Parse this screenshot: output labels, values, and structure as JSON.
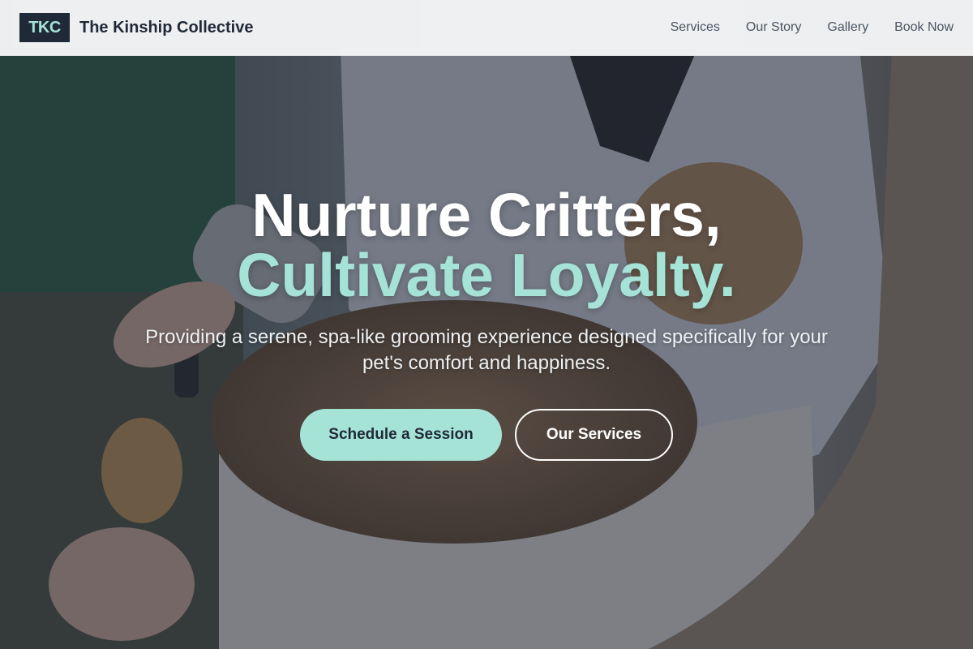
{
  "brand": {
    "logo_text": "TKC",
    "name": "The Kinship Collective"
  },
  "nav": {
    "items": [
      "Services",
      "Our Story",
      "Gallery",
      "Book Now"
    ]
  },
  "hero": {
    "headline_line1": "Nurture Critters,",
    "headline_line2": "Cultivate Loyalty.",
    "subtext": "Providing a serene, spa-like grooming experience designed specifically for your pet's comfort and happiness.",
    "primary_cta": "Schedule a Session",
    "secondary_cta": "Our Services"
  },
  "colors": {
    "accent": "#a6e3d7",
    "dark": "#1f2937",
    "nav_text": "#4b5563"
  }
}
